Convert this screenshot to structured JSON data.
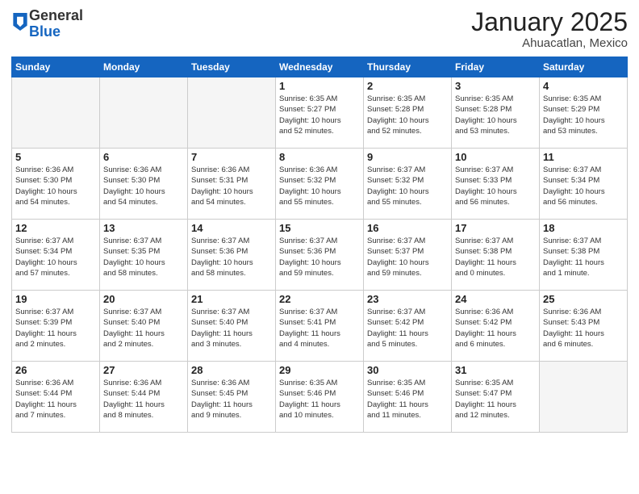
{
  "header": {
    "logo_general": "General",
    "logo_blue": "Blue",
    "month_title": "January 2025",
    "location": "Ahuacatlan, Mexico"
  },
  "days_of_week": [
    "Sunday",
    "Monday",
    "Tuesday",
    "Wednesday",
    "Thursday",
    "Friday",
    "Saturday"
  ],
  "weeks": [
    [
      {
        "day": null,
        "info": null
      },
      {
        "day": null,
        "info": null
      },
      {
        "day": null,
        "info": null
      },
      {
        "day": "1",
        "info": "Sunrise: 6:35 AM\nSunset: 5:27 PM\nDaylight: 10 hours\nand 52 minutes."
      },
      {
        "day": "2",
        "info": "Sunrise: 6:35 AM\nSunset: 5:28 PM\nDaylight: 10 hours\nand 52 minutes."
      },
      {
        "day": "3",
        "info": "Sunrise: 6:35 AM\nSunset: 5:28 PM\nDaylight: 10 hours\nand 53 minutes."
      },
      {
        "day": "4",
        "info": "Sunrise: 6:35 AM\nSunset: 5:29 PM\nDaylight: 10 hours\nand 53 minutes."
      }
    ],
    [
      {
        "day": "5",
        "info": "Sunrise: 6:36 AM\nSunset: 5:30 PM\nDaylight: 10 hours\nand 54 minutes."
      },
      {
        "day": "6",
        "info": "Sunrise: 6:36 AM\nSunset: 5:30 PM\nDaylight: 10 hours\nand 54 minutes."
      },
      {
        "day": "7",
        "info": "Sunrise: 6:36 AM\nSunset: 5:31 PM\nDaylight: 10 hours\nand 54 minutes."
      },
      {
        "day": "8",
        "info": "Sunrise: 6:36 AM\nSunset: 5:32 PM\nDaylight: 10 hours\nand 55 minutes."
      },
      {
        "day": "9",
        "info": "Sunrise: 6:37 AM\nSunset: 5:32 PM\nDaylight: 10 hours\nand 55 minutes."
      },
      {
        "day": "10",
        "info": "Sunrise: 6:37 AM\nSunset: 5:33 PM\nDaylight: 10 hours\nand 56 minutes."
      },
      {
        "day": "11",
        "info": "Sunrise: 6:37 AM\nSunset: 5:34 PM\nDaylight: 10 hours\nand 56 minutes."
      }
    ],
    [
      {
        "day": "12",
        "info": "Sunrise: 6:37 AM\nSunset: 5:34 PM\nDaylight: 10 hours\nand 57 minutes."
      },
      {
        "day": "13",
        "info": "Sunrise: 6:37 AM\nSunset: 5:35 PM\nDaylight: 10 hours\nand 58 minutes."
      },
      {
        "day": "14",
        "info": "Sunrise: 6:37 AM\nSunset: 5:36 PM\nDaylight: 10 hours\nand 58 minutes."
      },
      {
        "day": "15",
        "info": "Sunrise: 6:37 AM\nSunset: 5:36 PM\nDaylight: 10 hours\nand 59 minutes."
      },
      {
        "day": "16",
        "info": "Sunrise: 6:37 AM\nSunset: 5:37 PM\nDaylight: 10 hours\nand 59 minutes."
      },
      {
        "day": "17",
        "info": "Sunrise: 6:37 AM\nSunset: 5:38 PM\nDaylight: 11 hours\nand 0 minutes."
      },
      {
        "day": "18",
        "info": "Sunrise: 6:37 AM\nSunset: 5:38 PM\nDaylight: 11 hours\nand 1 minute."
      }
    ],
    [
      {
        "day": "19",
        "info": "Sunrise: 6:37 AM\nSunset: 5:39 PM\nDaylight: 11 hours\nand 2 minutes."
      },
      {
        "day": "20",
        "info": "Sunrise: 6:37 AM\nSunset: 5:40 PM\nDaylight: 11 hours\nand 2 minutes."
      },
      {
        "day": "21",
        "info": "Sunrise: 6:37 AM\nSunset: 5:40 PM\nDaylight: 11 hours\nand 3 minutes."
      },
      {
        "day": "22",
        "info": "Sunrise: 6:37 AM\nSunset: 5:41 PM\nDaylight: 11 hours\nand 4 minutes."
      },
      {
        "day": "23",
        "info": "Sunrise: 6:37 AM\nSunset: 5:42 PM\nDaylight: 11 hours\nand 5 minutes."
      },
      {
        "day": "24",
        "info": "Sunrise: 6:36 AM\nSunset: 5:42 PM\nDaylight: 11 hours\nand 6 minutes."
      },
      {
        "day": "25",
        "info": "Sunrise: 6:36 AM\nSunset: 5:43 PM\nDaylight: 11 hours\nand 6 minutes."
      }
    ],
    [
      {
        "day": "26",
        "info": "Sunrise: 6:36 AM\nSunset: 5:44 PM\nDaylight: 11 hours\nand 7 minutes."
      },
      {
        "day": "27",
        "info": "Sunrise: 6:36 AM\nSunset: 5:44 PM\nDaylight: 11 hours\nand 8 minutes."
      },
      {
        "day": "28",
        "info": "Sunrise: 6:36 AM\nSunset: 5:45 PM\nDaylight: 11 hours\nand 9 minutes."
      },
      {
        "day": "29",
        "info": "Sunrise: 6:35 AM\nSunset: 5:46 PM\nDaylight: 11 hours\nand 10 minutes."
      },
      {
        "day": "30",
        "info": "Sunrise: 6:35 AM\nSunset: 5:46 PM\nDaylight: 11 hours\nand 11 minutes."
      },
      {
        "day": "31",
        "info": "Sunrise: 6:35 AM\nSunset: 5:47 PM\nDaylight: 11 hours\nand 12 minutes."
      },
      {
        "day": null,
        "info": null
      }
    ]
  ]
}
